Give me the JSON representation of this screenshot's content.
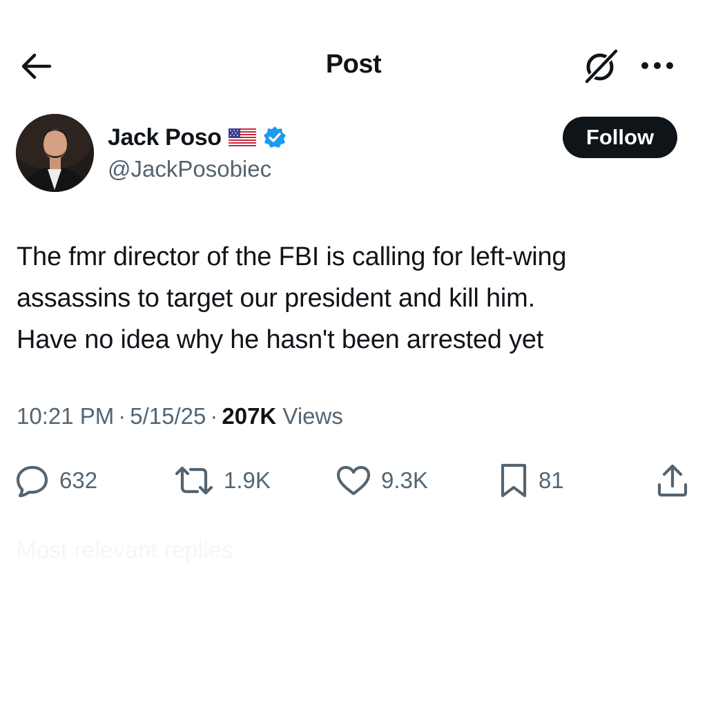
{
  "header": {
    "title": "Post",
    "back_icon": "arrow-left-icon",
    "grok_icon": "grok-icon",
    "more_icon": "more-dots-icon"
  },
  "author": {
    "name": "Jack Poso",
    "handle": "@JackPosobiec",
    "flag_icon": "us-flag-icon",
    "verified_icon": "verified-badge-icon",
    "verified_color": "#1d9bf0"
  },
  "follow": {
    "label": "Follow"
  },
  "post": {
    "lines": [
      "The fmr director of the FBI is calling for left-wing",
      "assassins to target our president and kill him.",
      "Have no idea why he hasn't been arrested yet"
    ]
  },
  "meta": {
    "time": "10:21 PM",
    "date": "5/15/25",
    "views_count": "207K",
    "views_label": "Views",
    "separator": "·"
  },
  "actions": {
    "replies": "632",
    "reposts": "1.9K",
    "likes": "9.3K",
    "bookmarks": "81"
  },
  "faded": {
    "text": "Most relevant replies"
  },
  "colors": {
    "text": "#0f1419",
    "secondary": "#536471",
    "button_bg": "#0f1419"
  }
}
